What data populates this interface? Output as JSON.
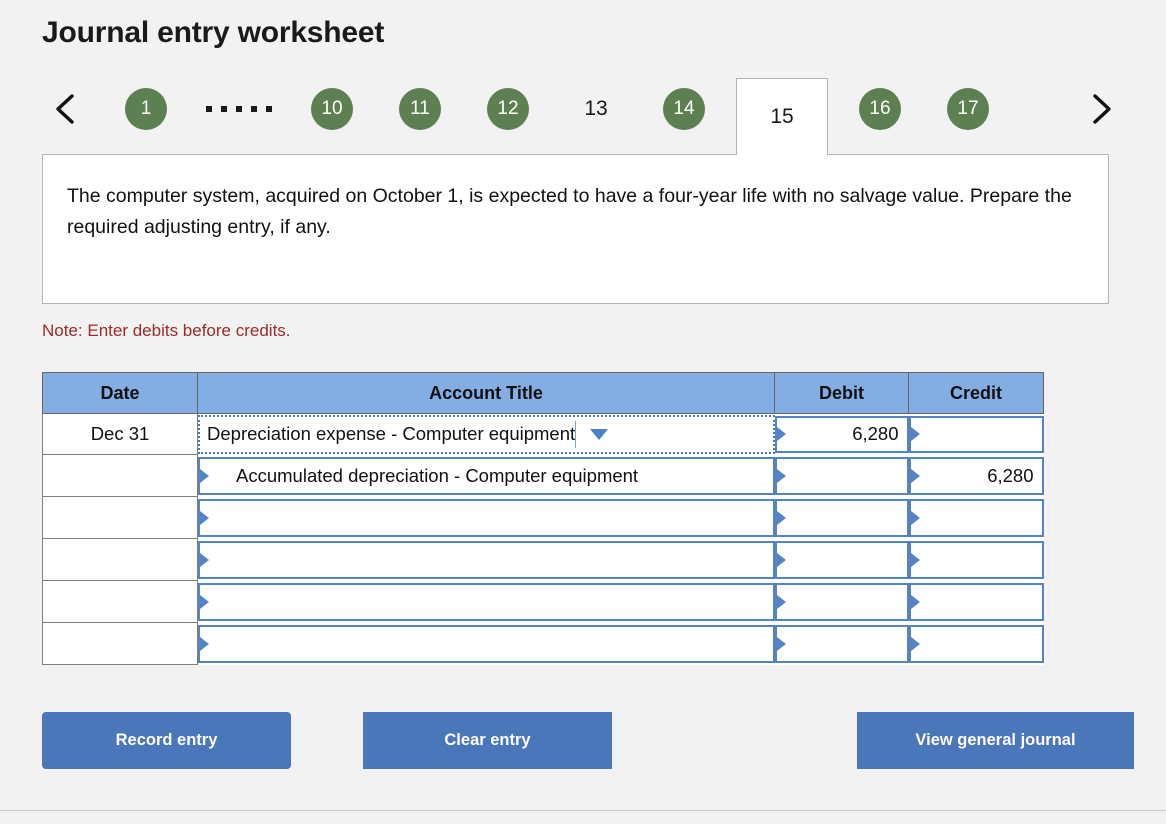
{
  "page": {
    "title": "Journal entry worksheet",
    "note": "Note: Enter debits before credits."
  },
  "tabs": {
    "prev_icon": "chevron-left-icon",
    "next_icon": "chevron-right-icon",
    "ellipsis_dots": 5,
    "items": [
      {
        "label": "1",
        "state": "completed"
      },
      {
        "label": "10",
        "state": "completed"
      },
      {
        "label": "11",
        "state": "completed"
      },
      {
        "label": "12",
        "state": "completed"
      },
      {
        "label": "13",
        "state": "plain"
      },
      {
        "label": "14",
        "state": "completed"
      },
      {
        "label": "15",
        "state": "active"
      },
      {
        "label": "16",
        "state": "completed"
      },
      {
        "label": "17",
        "state": "completed"
      }
    ],
    "active_label": "15"
  },
  "question": {
    "text": "The computer system, acquired on October 1, is expected to have a four-year life with no salvage value. Prepare the required adjusting entry, if any."
  },
  "journal": {
    "columns": [
      "Date",
      "Account Title",
      "Debit",
      "Credit"
    ],
    "rows": [
      {
        "date": "Dec 31",
        "account": "Depreciation expense - Computer equipment",
        "debit": "6,280",
        "credit": "",
        "selected": true,
        "indent": false,
        "dropdown_icon": "chevron-down-icon"
      },
      {
        "date": "",
        "account": "Accumulated depreciation - Computer equipment",
        "debit": "",
        "credit": "6,280",
        "selected": false,
        "indent": true
      },
      {
        "date": "",
        "account": "",
        "debit": "",
        "credit": "",
        "selected": false,
        "indent": false
      },
      {
        "date": "",
        "account": "",
        "debit": "",
        "credit": "",
        "selected": false,
        "indent": false
      },
      {
        "date": "",
        "account": "",
        "debit": "",
        "credit": "",
        "selected": false,
        "indent": false
      },
      {
        "date": "",
        "account": "",
        "debit": "",
        "credit": "",
        "selected": false,
        "indent": false
      }
    ]
  },
  "buttons": {
    "record": "Record entry",
    "clear": "Clear entry",
    "view": "View general journal"
  },
  "colors": {
    "page_bg": "#f2f2f2",
    "tab_green": "#5d8052",
    "header_blue": "#84ade4",
    "cell_border_blue": "#5584c4",
    "button_blue": "#4a76ba",
    "note_red": "#9e2a2a"
  }
}
